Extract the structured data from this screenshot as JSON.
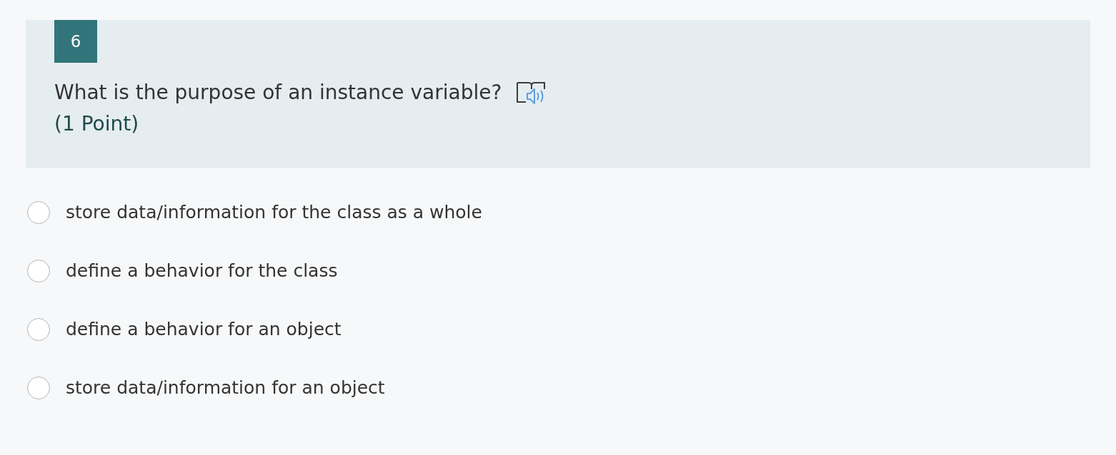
{
  "question": {
    "number": "6",
    "text": "What is the purpose of an instance variable?",
    "points": "(1 Point)"
  },
  "options": [
    {
      "label": "store data/information for the class as a whole",
      "selected": false
    },
    {
      "label": "define a behavior for the class",
      "selected": false
    },
    {
      "label": "define a behavior for an object",
      "selected": false
    },
    {
      "label": "store data/information for an object",
      "selected": false
    }
  ]
}
